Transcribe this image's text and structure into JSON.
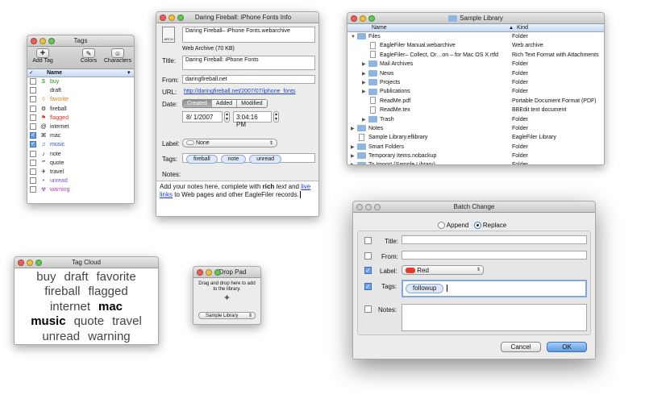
{
  "tags_window": {
    "title": "Tags",
    "toolbar": {
      "add_label": "Add Tag",
      "colors_label": "Colors",
      "characters_label": "Characters"
    },
    "column_check": "✓",
    "column_name": "Name",
    "items": [
      {
        "symbol": "$",
        "name": "buy",
        "color": "#1a9a1a",
        "checked": false
      },
      {
        "symbol": "",
        "name": "draft",
        "color": "#222222",
        "checked": false
      },
      {
        "symbol": "◊",
        "name": "favorite",
        "color": "#e07a10",
        "checked": false
      },
      {
        "symbol": "⚙",
        "name": "fireball",
        "color": "#222222",
        "checked": false
      },
      {
        "symbol": "⚑",
        "name": "flagged",
        "color": "#d43a2a",
        "checked": false
      },
      {
        "symbol": "@",
        "name": "internet",
        "color": "#222222",
        "checked": false
      },
      {
        "symbol": "⌘",
        "name": "mac",
        "color": "#222222",
        "checked": true
      },
      {
        "symbol": "♫",
        "name": "music",
        "color": "#2c4fc7",
        "checked": true
      },
      {
        "symbol": "♪",
        "name": "note",
        "color": "#222222",
        "checked": false
      },
      {
        "symbol": "“”",
        "name": "quote",
        "color": "#222222",
        "checked": false
      },
      {
        "symbol": "✈",
        "name": "travel",
        "color": "#222222",
        "checked": false
      },
      {
        "symbol": "•",
        "name": "unread",
        "color": "#6f54c8",
        "checked": false
      },
      {
        "symbol": "☢",
        "name": "warning",
        "color": "#b040b8",
        "checked": false
      }
    ]
  },
  "info_window": {
    "title": "Daring Fireball: iPhone Fonts Info",
    "filename": "Daring Fireball– iPhone Fonts.webarchive",
    "filetype": "Web Archive (70 KB)",
    "icon_caption": "ARCH",
    "title_label": "Title:",
    "title_value": "Daring Fireball: iPhone Fonts",
    "from_label": "From:",
    "from_value": "daringfireball.net",
    "url_label": "URL:",
    "url_value": "http://daringfireball.net/2007/07/iphone_fonts",
    "date_label": "Date:",
    "date_tabs": [
      "Created",
      "Added",
      "Modified"
    ],
    "date_value": "8/ 1/2007",
    "time_value": "3:04:16 PM",
    "label_label": "Label:",
    "label_value": "None",
    "tags_label": "Tags:",
    "tags": [
      "fireball",
      "note",
      "unread"
    ],
    "notes_label": "Notes:",
    "notes_part1": "Add your notes here, complete with ",
    "notes_rich": "rich",
    "notes_space": " ",
    "notes_text_italic": "text",
    "notes_and": " and ",
    "notes_link": "live links",
    "notes_part2": " to Web pages and other EagleFiler records."
  },
  "library_window": {
    "title": "Sample Library",
    "col_name": "Name",
    "col_kind": "Kind",
    "rows": [
      {
        "indent": 0,
        "tri": "▼",
        "icon": "folder",
        "name": "Files",
        "kind": "Folder"
      },
      {
        "indent": 1,
        "tri": "",
        "icon": "doc",
        "name": "EagleFiler Manual.webarchive",
        "kind": "Web archive"
      },
      {
        "indent": 1,
        "tri": "",
        "icon": "doc",
        "name": "EagleFiler– Collect, Or…on – for Mac OS X.rtfd",
        "kind": "Rich Text Format with Attachments"
      },
      {
        "indent": 1,
        "tri": "▶",
        "icon": "folder",
        "name": "Mail Archives",
        "kind": "Folder"
      },
      {
        "indent": 1,
        "tri": "▶",
        "icon": "folder",
        "name": "News",
        "kind": "Folder"
      },
      {
        "indent": 1,
        "tri": "▶",
        "icon": "folder",
        "name": "Projects",
        "kind": "Folder"
      },
      {
        "indent": 1,
        "tri": "▶",
        "icon": "folder",
        "name": "Publications",
        "kind": "Folder"
      },
      {
        "indent": 1,
        "tri": "",
        "icon": "doc",
        "name": "ReadMe.pdf",
        "kind": "Portable Document Format (PDF)"
      },
      {
        "indent": 1,
        "tri": "",
        "icon": "doc",
        "name": "ReadMe.tex",
        "kind": "BBEdit text document"
      },
      {
        "indent": 1,
        "tri": "▶",
        "icon": "folder",
        "name": "Trash",
        "kind": "Folder"
      },
      {
        "indent": 0,
        "tri": "▶",
        "icon": "folder",
        "name": "Notes",
        "kind": "Folder"
      },
      {
        "indent": 0,
        "tri": "",
        "icon": "doc",
        "name": "Sample Library.eflibrary",
        "kind": "EagleFiler Library"
      },
      {
        "indent": 0,
        "tri": "▶",
        "icon": "folder",
        "name": "Smart Folders",
        "kind": "Folder"
      },
      {
        "indent": 0,
        "tri": "▶",
        "icon": "folder",
        "name": "Temporary Items.nobackup",
        "kind": "Folder"
      },
      {
        "indent": 0,
        "tri": "▶",
        "icon": "folder",
        "name": "To Import (Sample Library)",
        "kind": "Folder"
      }
    ]
  },
  "tag_cloud": {
    "title": "Tag Cloud",
    "lines": [
      [
        "buy",
        "draft",
        "favorite"
      ],
      [
        "fireball",
        "flagged"
      ],
      [
        "internet",
        "mac"
      ],
      [
        "music",
        "quote",
        "travel"
      ],
      [
        "unread",
        "warning"
      ]
    ],
    "bold_words": [
      "mac",
      "music"
    ]
  },
  "drop_pad": {
    "title": "Drop Pad",
    "text": "Drag and drop here to add to the library.",
    "library": "Sample Library"
  },
  "batch_change": {
    "title": "Batch Change",
    "append_label": "Append",
    "replace_label": "Replace",
    "mode": "replace",
    "fields": {
      "title": {
        "label": "Title:",
        "checked": false,
        "value": ""
      },
      "from": {
        "label": "From:",
        "checked": false,
        "value": ""
      },
      "label": {
        "label": "Label:",
        "checked": true,
        "value": "Red",
        "color": "#e8392c"
      },
      "tags": {
        "label": "Tags:",
        "checked": true,
        "value": "followup"
      },
      "notes": {
        "label": "Notes:",
        "checked": false,
        "value": ""
      }
    },
    "cancel_label": "Cancel",
    "ok_label": "OK"
  }
}
